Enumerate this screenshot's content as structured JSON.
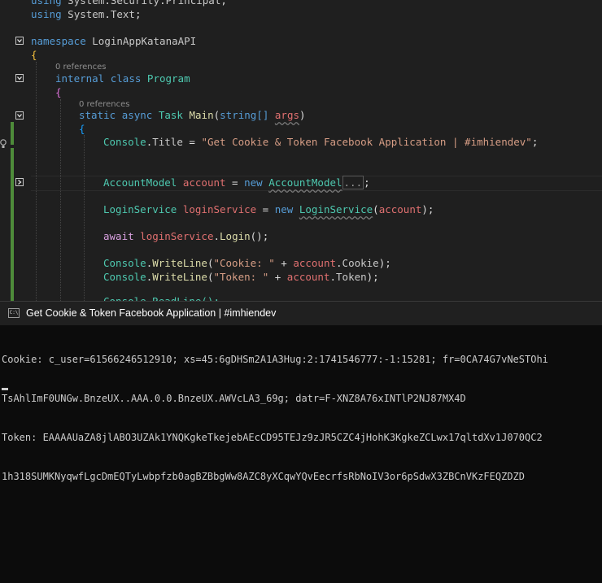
{
  "editor": {
    "using_lines": [
      {
        "kw": "using",
        "ns1": "System",
        "ns2": "Security",
        "ns3": "Principal"
      },
      {
        "kw": "using",
        "ns1": "System",
        "ns2": "Text"
      }
    ],
    "namespace_kw": "namespace",
    "namespace_name": "LoginAppKatanaAPI",
    "open_brace": "{",
    "references_label": "0 references",
    "class_kw1": "internal",
    "class_kw2": "class",
    "class_name": "Program",
    "method": {
      "kw1": "static",
      "kw2": "async",
      "ret": "Task",
      "name": "Main",
      "param_type": "string[]",
      "param_name": "args"
    },
    "title_stmt": {
      "obj": "Console",
      "prop": "Title",
      "value": "\"Get Cookie & Token Facebook Application | #imhiendev\""
    },
    "account_stmt": {
      "type": "AccountModel",
      "var": "account",
      "kw": "new",
      "ctor": "AccountModel",
      "collapsed": "..."
    },
    "service_stmt": {
      "type": "LoginService",
      "var": "loginService",
      "kw": "new",
      "ctor": "LoginService",
      "arg": "account"
    },
    "await_stmt": {
      "kw": "await",
      "var": "loginService",
      "method": "Login"
    },
    "writeline1": {
      "obj": "Console",
      "method": "WriteLine",
      "str": "\"Cookie: \"",
      "var": "account",
      "prop": "Cookie"
    },
    "writeline2": {
      "obj": "Console",
      "method": "WriteLine",
      "str": "\"Token: \"",
      "var": "account",
      "prop": "Token"
    },
    "partial_line": "Console.ReadLine();"
  },
  "console": {
    "title": "Get Cookie & Token Facebook Application | #imhiendev",
    "icon_text": "C:\\",
    "lines": [
      "Cookie: c_user=61566246512910; xs=45:6gDHSm2A1A3Hug:2:1741546777:-1:15281; fr=0CA74G7vNeSTOhi",
      "TsAhlImF0UNGw.BnzeUX..AAA.0.0.BnzeUX.AWVcLA3_69g; datr=F-XNZ8A76xINTlP2NJ87MX4D",
      "Token: EAAAAUaZA8jlABO3UZAk1YNQKgkeTkejebAEcCD95TEJz9zJR5CZC4jHohK3KgkeZCLwx17qltdXv1J070QC2",
      "1h318SUMKNyqwfLgcDmEQTyLwbpfzb0agBZBbgWw8AZC8yXCqwYQvEecrfsRbNoIV3or6pSdwX3ZBCnVKzFEQZDZD"
    ]
  },
  "colors": {
    "keyword": "#569cd6",
    "control_keyword": "#d8a0df",
    "type": "#4ec9b0",
    "method": "#dcdcaa",
    "string": "#d69d85",
    "variable": "#e07070",
    "change_bar": "#4e8b3a",
    "console_bg": "#0c0c0c"
  }
}
